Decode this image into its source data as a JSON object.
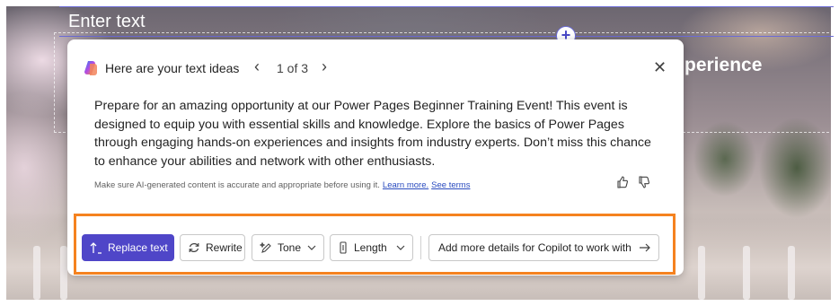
{
  "editor": {
    "placeholder_text": "Enter text",
    "background_heading": "perience"
  },
  "panel": {
    "title": "Here are your text ideas",
    "pager": "1 of 3",
    "body": "Prepare for an amazing opportunity at our Power Pages Beginner Training Event! This event is designed to equip you with essential skills and knowledge. Explore the basics of Power Pages through engaging hands-on experiences and insights from industry experts. Don’t miss this chance to enhance your abilities and network with other enthusiasts.",
    "disclaimer": "Make sure AI-generated content is accurate and appropriate before using it.",
    "learn_more": "Learn more.",
    "see_terms": "See terms"
  },
  "actions": {
    "replace_text": "Replace text",
    "rewrite": "Rewrite",
    "tone": "Tone",
    "length": "Length",
    "add_details": "Add more details for Copilot to work with"
  },
  "colors": {
    "primary": "#4f46c8",
    "highlight": "#f5821f"
  },
  "icons": {
    "copilot": "copilot-icon",
    "prev": "chevron-left-icon",
    "next": "chevron-right-icon",
    "close": "close-icon",
    "thumbs_up": "thumbs-up-icon",
    "thumbs_down": "thumbs-down-icon",
    "replace": "arrow-up-icon",
    "rewrite": "refresh-icon",
    "tone": "sparkle-pen-icon",
    "length": "text-length-icon",
    "arrow_right": "arrow-right-icon"
  }
}
